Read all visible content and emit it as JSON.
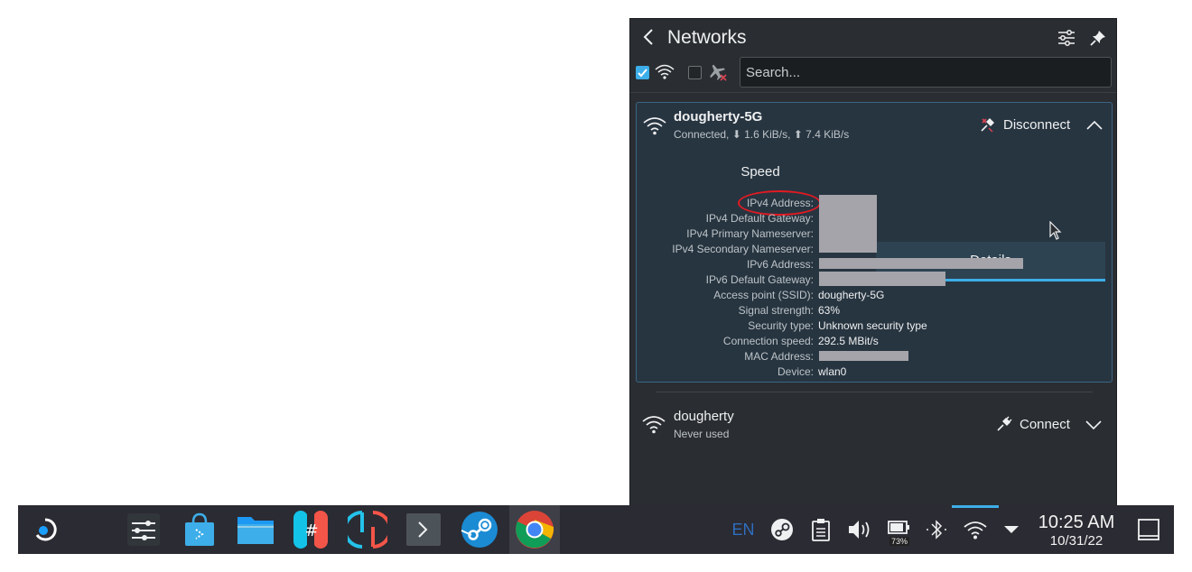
{
  "popup": {
    "title": "Networks",
    "search_placeholder": "Search..."
  },
  "active_network": {
    "name": "dougherty-5G",
    "status": "Connected, ⬇ 1.6 KiB/s, ⬆ 7.4 KiB/s",
    "action": "Disconnect",
    "tabs": [
      "Speed",
      "Details"
    ],
    "selected_tab": "Details",
    "details": [
      {
        "label": "IPv4 Address:",
        "value": ""
      },
      {
        "label": "IPv4 Default Gateway:",
        "value": ""
      },
      {
        "label": "IPv4 Primary Nameserver:",
        "value": ""
      },
      {
        "label": "IPv4 Secondary Nameserver:",
        "value": ""
      },
      {
        "label": "IPv6 Address:",
        "value": ""
      },
      {
        "label": "IPv6 Default Gateway:",
        "value": ""
      },
      {
        "label": "Access point (SSID):",
        "value": "dougherty-5G"
      },
      {
        "label": "Signal strength:",
        "value": "63%"
      },
      {
        "label": "Security type:",
        "value": "Unknown security type"
      },
      {
        "label": "Connection speed:",
        "value": "292.5 MBit/s"
      },
      {
        "label": "MAC Address:",
        "value": ""
      },
      {
        "label": "Device:",
        "value": "wlan0"
      }
    ]
  },
  "other_network": {
    "name": "dougherty",
    "status": "Never used",
    "action": "Connect"
  },
  "taskbar": {
    "language": "EN",
    "battery_percent": "73%",
    "clock_time": "10:25 AM",
    "clock_date": "10/31/22"
  },
  "colors": {
    "accent": "#3daee9",
    "panel": "#2a2e32",
    "card": "#273541",
    "taskbar": "#2b2b33",
    "highlight_circle": "#e11a22"
  }
}
